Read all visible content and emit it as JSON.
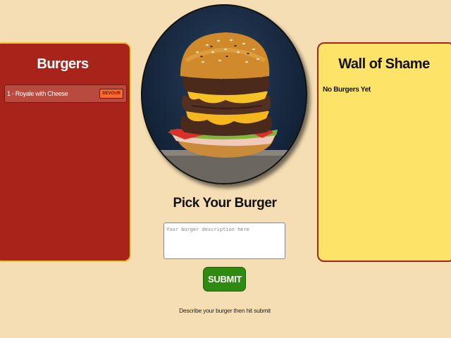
{
  "burgers_panel": {
    "title": "Burgers",
    "items": [
      {
        "label": "1 - Royale with Cheese",
        "action_label": "DEVOUR"
      }
    ]
  },
  "shame_panel": {
    "title": "Wall of Shame",
    "empty_text": "No Burgers Yet"
  },
  "form": {
    "title": "Pick Your Burger",
    "placeholder": "Your burger description here",
    "value": "",
    "submit_label": "SUBMIT",
    "hint": "Describe your burger then hit submit"
  },
  "colors": {
    "background": "#f5deb3",
    "burgers_panel": "#a8241a",
    "shame_panel": "#fde468",
    "submit": "#2f8a12",
    "devour": "#ff6a2b"
  },
  "icons": {
    "hero": "burger-photo"
  }
}
